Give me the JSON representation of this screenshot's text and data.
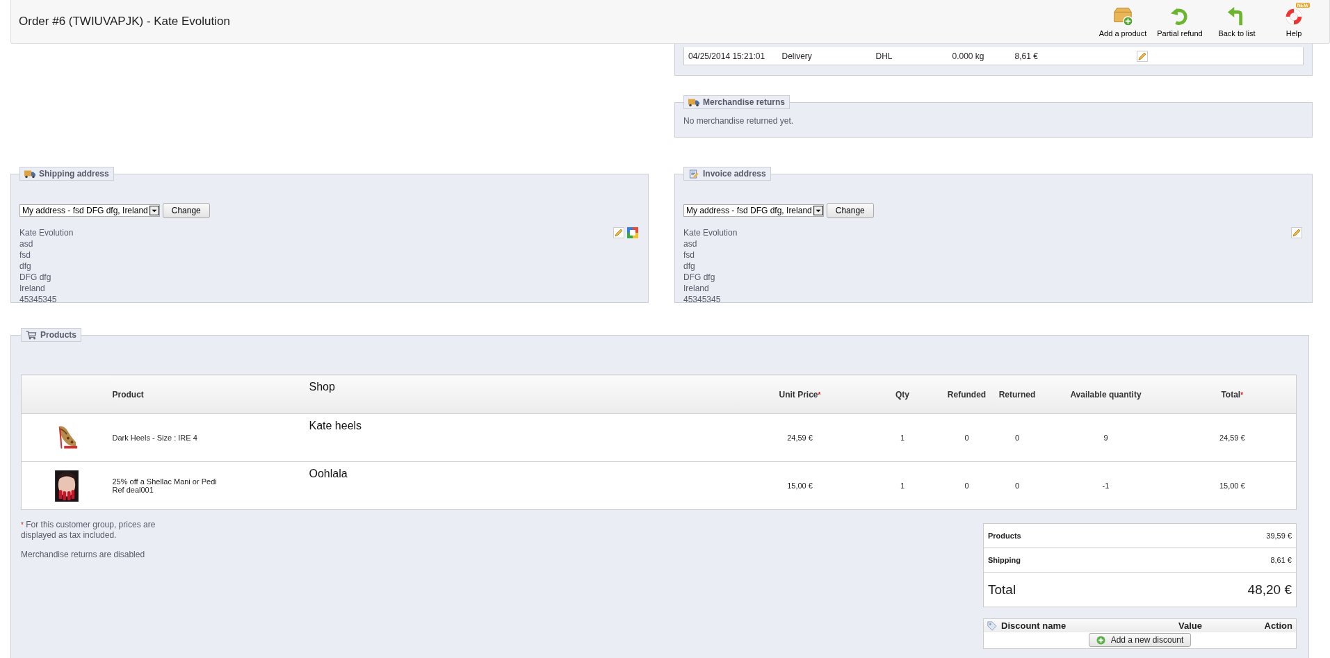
{
  "header": {
    "title": "Order #6 (TWIUVAPJK) - Kate Evolution",
    "toolbar": [
      {
        "label": "Add a product",
        "kind": "add"
      },
      {
        "label": "Partial refund",
        "kind": "refund"
      },
      {
        "label": "Back to list",
        "kind": "back"
      },
      {
        "label": "Help",
        "kind": "help",
        "badge": "NEW"
      }
    ]
  },
  "shipping": {
    "rows": [
      {
        "cells": [
          "04/25/2014 15:21:01",
          "Delivery",
          "DHL",
          "0.000 kg",
          "8,61 €"
        ]
      }
    ]
  },
  "merchandise_returns": {
    "title": "Merchandise returns",
    "message": "No merchandise returned yet."
  },
  "addresses": [
    {
      "kind": "shipping",
      "title": "Shipping address",
      "select_value": "My address - fsd DFG dfg, Ireland",
      "button": "Change",
      "lines": [
        "Kate Evolution",
        "asd",
        "fsd",
        "dfg",
        "DFG dfg",
        "Ireland",
        "45345345"
      ],
      "map_link": true
    },
    {
      "kind": "invoice",
      "title": "Invoice address",
      "select_value": "My address - fsd DFG dfg, Ireland",
      "button": "Change",
      "lines": [
        "Kate Evolution",
        "asd",
        "fsd",
        "dfg",
        "DFG dfg",
        "Ireland",
        "45345345"
      ],
      "map_link": false
    }
  ],
  "products": {
    "title": "Products",
    "columns": [
      {
        "label": "Product"
      },
      {
        "label": "Shop"
      },
      {
        "label": "Unit Price",
        "mark": "*"
      },
      {
        "label": "Qty"
      },
      {
        "label": "Refunded"
      },
      {
        "label": "Returned"
      },
      {
        "label": "Available quantity"
      },
      {
        "label": "Total",
        "mark": "*"
      }
    ],
    "rows": [
      {
        "kind": "shoe",
        "name": "Dark Heels - Size : IRE 4",
        "shop": "Kate heels",
        "unit_price": "24,59 €",
        "qty": "1",
        "refunded": "0",
        "returned": "0",
        "available": "9",
        "total": "24,59 €"
      },
      {
        "kind": "beauty",
        "name": "25% off a Shellac Mani or Pedi",
        "reference": "Ref deal001",
        "shop": "Oohlala",
        "unit_price": "15,00 €",
        "qty": "1",
        "refunded": "0",
        "returned": "0",
        "available": "-1",
        "total": "15,00 €"
      }
    ],
    "footnote_mark": "*",
    "footnote": "For this customer group, prices are displayed as tax included.",
    "returns_note": "Merchandise returns are disabled",
    "totals": [
      {
        "kind": "line",
        "label": "Products",
        "value": "39,59 €"
      },
      {
        "kind": "line",
        "label": "Shipping",
        "value": "8,61 €"
      },
      {
        "kind": "grand",
        "label": "Total",
        "value": "48,20 €"
      }
    ],
    "discounts": {
      "columns": [
        "Discount name",
        "Value",
        "Action"
      ],
      "button": "Add a new discount"
    }
  }
}
